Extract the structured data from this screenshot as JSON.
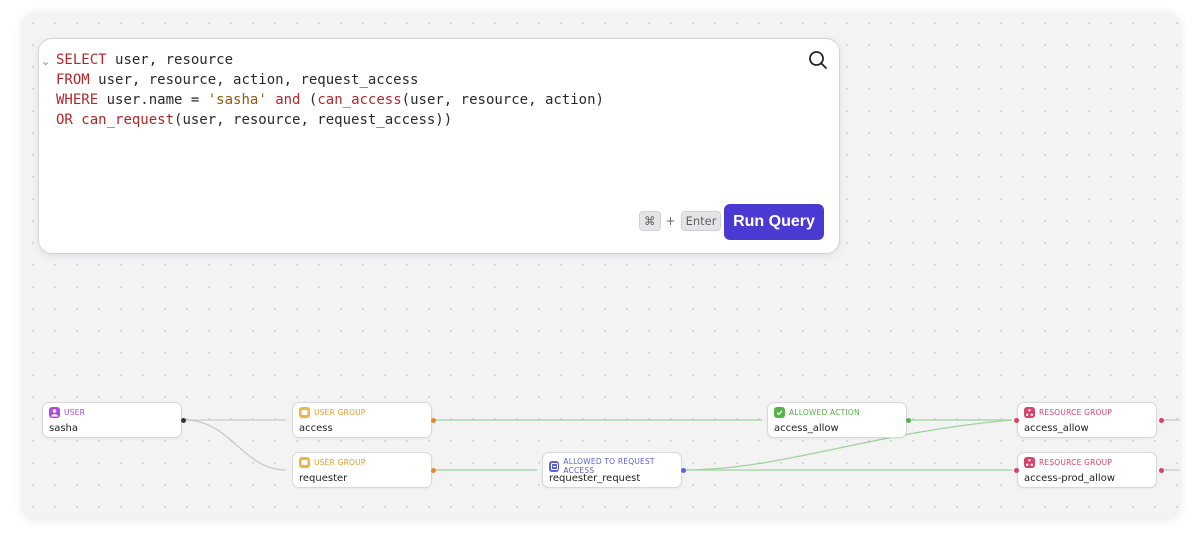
{
  "editor": {
    "code_lines": [
      "SELECT user, resource",
      "FROM user, resource, action, request_access",
      "WHERE user.name = 'sasha' and (can_access(user, resource, action)",
      "OR can_request(user, resource, request_access))"
    ],
    "shortcut_cmd": "⌘",
    "shortcut_plus": "+",
    "shortcut_key": "Enter",
    "run_label": "Run Query"
  },
  "graph": {
    "nodes": [
      {
        "type": "USER",
        "name": "sasha",
        "color": "#b04ad6"
      },
      {
        "type": "USER GROUP",
        "name": "access",
        "color": "#e89a2c"
      },
      {
        "type": "USER GROUP",
        "name": "requester",
        "color": "#e89a2c"
      },
      {
        "type": "ALLOWED TO REQUEST ACCESS",
        "name": "requester_request",
        "color": "#5c5fd6"
      },
      {
        "type": "ALLOWED ACTION",
        "name": "access_allow",
        "color": "#55b04a"
      },
      {
        "type": "RESOURCE GROUP",
        "name": "access_allow",
        "color": "#d9436b"
      },
      {
        "type": "RESOURCE GROUP",
        "name": "access-prod_allow",
        "color": "#d9436b"
      }
    ]
  }
}
